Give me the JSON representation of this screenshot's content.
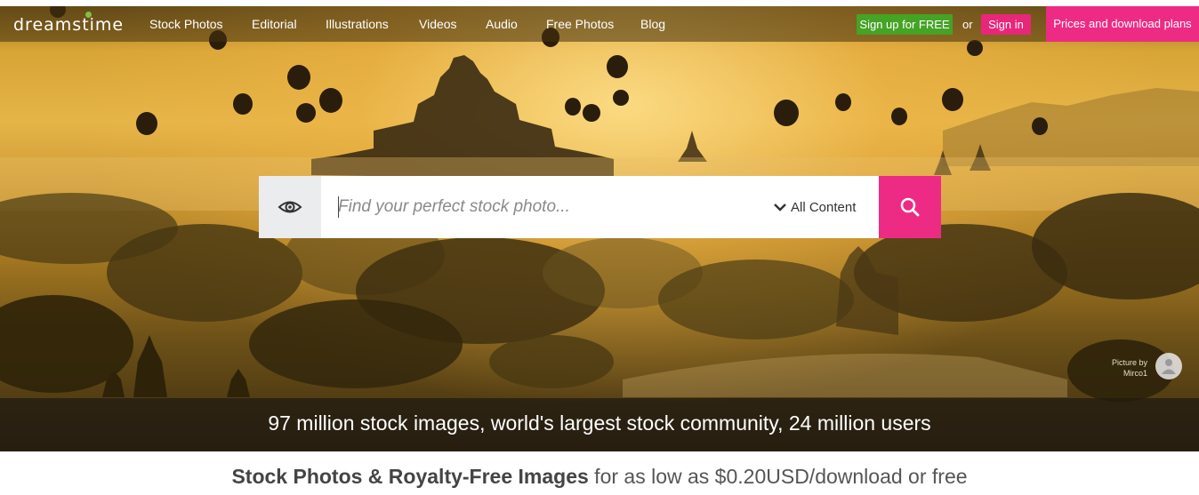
{
  "brand": {
    "logo_text": "dreamstime",
    "accent_green": "#45a325",
    "accent_pink": "#ee2b84"
  },
  "nav": {
    "items": [
      {
        "label": "Stock Photos"
      },
      {
        "label": "Editorial"
      },
      {
        "label": "Illustrations"
      },
      {
        "label": "Videos"
      },
      {
        "label": "Audio"
      },
      {
        "label": "Free Photos"
      },
      {
        "label": "Blog"
      }
    ],
    "signup_label": "Sign up for FREE",
    "or_text": "or",
    "signin_label": "Sign in",
    "prices_label": "Prices and download plans"
  },
  "search": {
    "placeholder": "Find your perfect stock photo...",
    "value": "",
    "filter_label": "All Content",
    "icons": {
      "left": "eye-icon",
      "filter": "chevron-down-icon",
      "submit": "search-icon"
    }
  },
  "hero": {
    "credit_label": "Picture by",
    "credit_name": "Mirco1",
    "tagline": "97 million stock images, world's largest stock community, 24 million users"
  },
  "subheading": {
    "bold": "Stock Photos & Royalty-Free Images",
    "rest": " for as low as $0.20USD/download or free"
  }
}
